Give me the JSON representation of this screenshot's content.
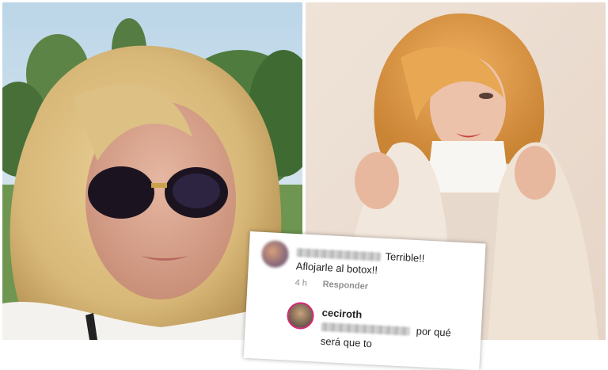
{
  "comments": [
    {
      "text_line1": "Terrible!!",
      "text_line2": "Aflojarle al botox!!",
      "time": "4 h",
      "reply_label": "Responder"
    },
    {
      "username": "ceciroth",
      "text_line1": "por qué",
      "text_line2": "será que to"
    }
  ],
  "colors": {
    "card_background": "#ffffff",
    "meta_text": "#8e8e8e",
    "avatar_ring": "#d62976"
  }
}
